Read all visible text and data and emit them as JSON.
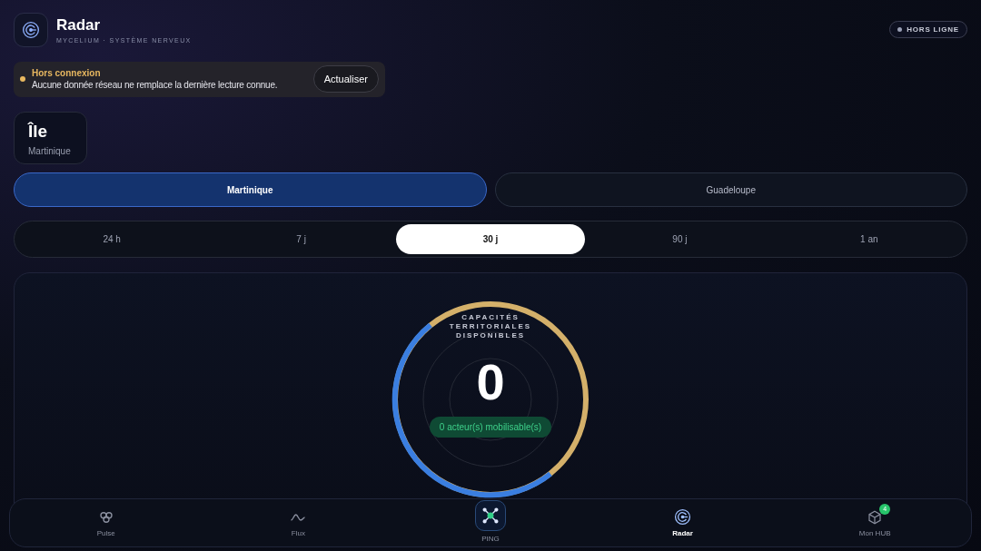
{
  "header": {
    "title": "Radar",
    "subtitle": "MYCELIUM · SYSTÈME NERVEUX",
    "status": "HORS LIGNE"
  },
  "banner": {
    "title": "Hors connexion",
    "message": "Aucune donnée réseau ne remplace la dernière lecture connue.",
    "button": "Actualiser"
  },
  "island_card": {
    "title": "Île",
    "value": "Martinique"
  },
  "islands": [
    {
      "label": "Martinique",
      "selected": true
    },
    {
      "label": "Guadeloupe",
      "selected": false
    }
  ],
  "periods": [
    {
      "label": "24 h",
      "selected": false
    },
    {
      "label": "7 j",
      "selected": false
    },
    {
      "label": "30 j",
      "selected": true
    },
    {
      "label": "90 j",
      "selected": false
    },
    {
      "label": "1 an",
      "selected": false
    }
  ],
  "gauge": {
    "label": "CAPACITÉS TERRITORIALES DISPONIBLES",
    "value": "0",
    "pill": "0 acteur(s) mobilisable(s)"
  },
  "nav": [
    {
      "label": "Pulse",
      "selected": false
    },
    {
      "label": "Flux",
      "selected": false
    },
    {
      "label": "PING",
      "selected": false
    },
    {
      "label": "Radar",
      "selected": true
    },
    {
      "label": "Mon HUB",
      "selected": false,
      "badge": "4"
    }
  ]
}
